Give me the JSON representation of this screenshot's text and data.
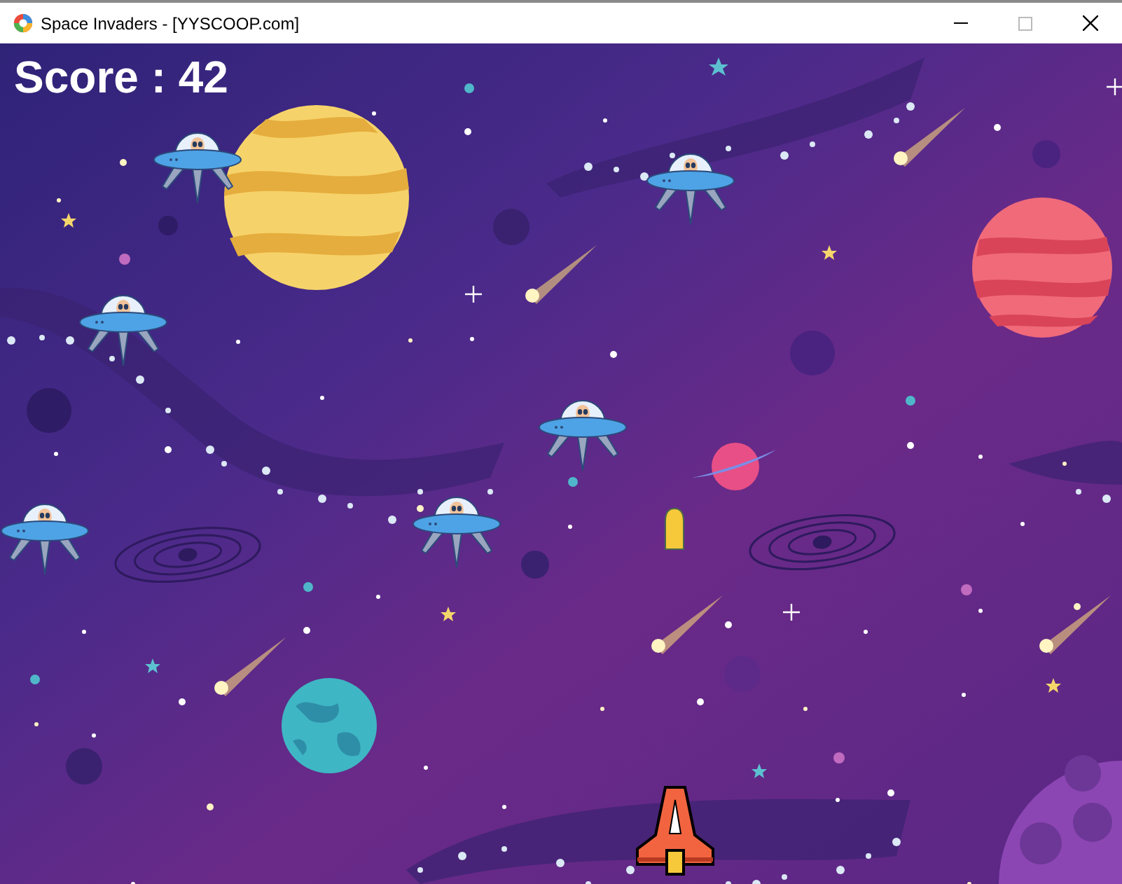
{
  "window": {
    "title": "Space Invaders - [YYSCOOP.com]"
  },
  "game": {
    "score_text": "Score : 42"
  }
}
